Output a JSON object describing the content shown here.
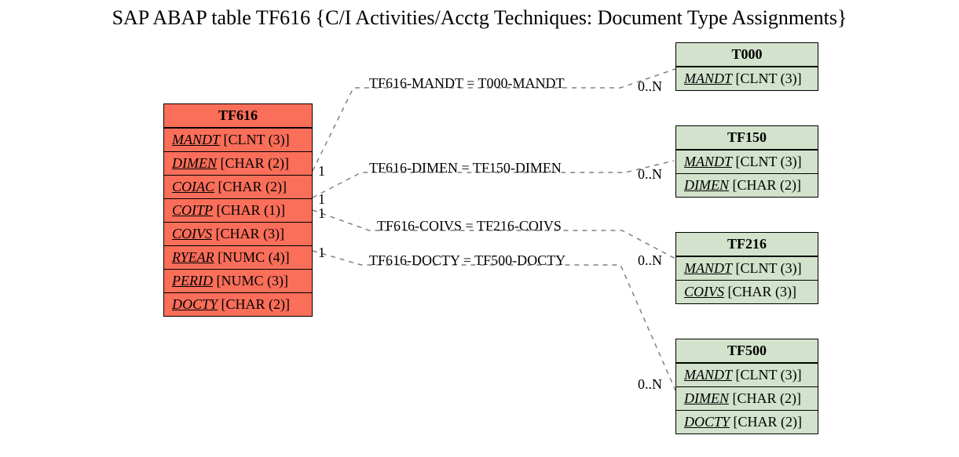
{
  "title": "SAP ABAP table TF616 {C/I Activities/Acctg Techniques: Document Type Assignments}",
  "colors": {
    "main": "#fa6e5a",
    "ref": "#d2e2cc",
    "border": "#000000"
  },
  "mainTable": {
    "name": "TF616",
    "fields": [
      {
        "name": "MANDT",
        "type": "[CLNT (3)]"
      },
      {
        "name": "DIMEN",
        "type": "[CHAR (2)]"
      },
      {
        "name": "COIAC",
        "type": "[CHAR (2)]"
      },
      {
        "name": "COITP",
        "type": "[CHAR (1)]"
      },
      {
        "name": "COIVS",
        "type": "[CHAR (3)]"
      },
      {
        "name": "RYEAR",
        "type": "[NUMC (4)]"
      },
      {
        "name": "PERID",
        "type": "[NUMC (3)]"
      },
      {
        "name": "DOCTY",
        "type": "[CHAR (2)]"
      }
    ]
  },
  "refTables": [
    {
      "name": "T000",
      "fields": [
        {
          "name": "MANDT",
          "type": "[CLNT (3)]"
        }
      ]
    },
    {
      "name": "TF150",
      "fields": [
        {
          "name": "MANDT",
          "type": "[CLNT (3)]"
        },
        {
          "name": "DIMEN",
          "type": "[CHAR (2)]"
        }
      ]
    },
    {
      "name": "TF216",
      "fields": [
        {
          "name": "MANDT",
          "type": "[CLNT (3)]"
        },
        {
          "name": "COIVS",
          "type": "[CHAR (3)]"
        }
      ]
    },
    {
      "name": "TF500",
      "fields": [
        {
          "name": "MANDT",
          "type": "[CLNT (3)]"
        },
        {
          "name": "DIMEN",
          "type": "[CHAR (2)]"
        },
        {
          "name": "DOCTY",
          "type": "[CHAR (2)]"
        }
      ]
    }
  ],
  "relations": [
    {
      "label": "TF616-MANDT = T000-MANDT",
      "leftCard": "1",
      "rightCard": "0..N"
    },
    {
      "label": "TF616-DIMEN = TF150-DIMEN",
      "leftCard": "1",
      "rightCard": "0..N"
    },
    {
      "label": "TF616-COIVS = TF216-COIVS",
      "leftCard": "1",
      "rightCard": "0..N"
    },
    {
      "label": "TF616-DOCTY = TF500-DOCTY",
      "leftCard": "1",
      "rightCard": "0..N"
    }
  ]
}
